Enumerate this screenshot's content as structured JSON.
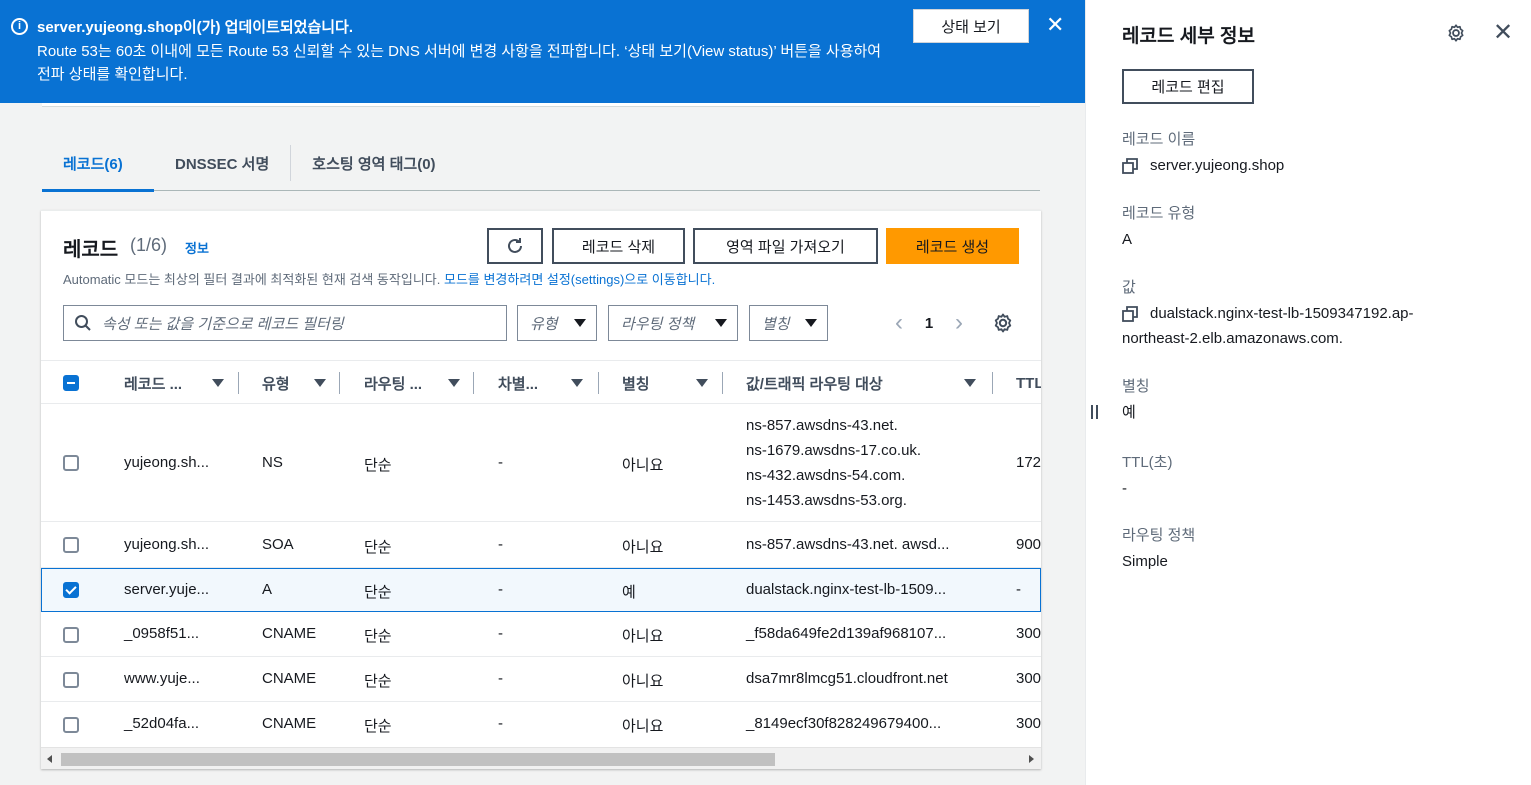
{
  "flash": {
    "icon": "info-icon",
    "title": "server.yujeong.shop이(가) 업데이트되었습니다.",
    "body": "Route 53는 60초 이내에 모든 Route 53 신뢰할 수 있는 DNS 서버에 변경 사항을 전파합니다. ‘상태 보기(View status)’ 버튼을 사용하여 전파 상태를 확인합니다.",
    "status_button": "상태 보기",
    "close_icon": "close-icon"
  },
  "tabs": [
    {
      "label": "레코드(6)",
      "active": true
    },
    {
      "label": "DNSSEC 서명",
      "active": false
    },
    {
      "label": "호스팅 영역 태그(0)",
      "active": false
    }
  ],
  "records": {
    "title": "레코드",
    "count": "(1/6)",
    "info_link": "정보",
    "description": "Automatic 모드는 최상의 필터 결과에 최적화된 현재 검색 동작입니다.",
    "description_link": "모드를 변경하려면 설정(settings)으로 이동합니다.",
    "buttons": {
      "delete": "레코드 삭제",
      "import": "영역 파일 가져오기",
      "create": "레코드 생성"
    },
    "filter_placeholder": "속성 또는 값을 기준으로 레코드 필터링",
    "dropdowns": {
      "type": "유형",
      "routing": "라우팅 정책",
      "alias": "별칭"
    },
    "page": "1",
    "columns": [
      "레코드 ...",
      "유형",
      "라우팅 ...",
      "차별...",
      "별칭",
      "값/트래픽 라우팅 대상",
      "TTL"
    ],
    "rows": [
      {
        "name": "yujeong.sh...",
        "type": "NS",
        "routing": "단순",
        "diff": "-",
        "alias": "아니요",
        "value": [
          "ns-857.awsdns-43.net.",
          "ns-1679.awsdns-17.co.uk.",
          "ns-432.awsdns-54.com.",
          "ns-1453.awsdns-53.org."
        ],
        "ttl": "172",
        "checked": false
      },
      {
        "name": "yujeong.sh...",
        "type": "SOA",
        "routing": "단순",
        "diff": "-",
        "alias": "아니요",
        "value": [
          "ns-857.awsdns-43.net. awsd..."
        ],
        "ttl": "900",
        "checked": false
      },
      {
        "name": "server.yuje...",
        "type": "A",
        "routing": "단순",
        "diff": "-",
        "alias": "예",
        "value": [
          "dualstack.nginx-test-lb-1509..."
        ],
        "ttl": "-",
        "checked": true
      },
      {
        "name": "_0958f51...",
        "type": "CNAME",
        "routing": "단순",
        "diff": "-",
        "alias": "아니요",
        "value": [
          "_f58da649fe2d139af968107..."
        ],
        "ttl": "300",
        "checked": false
      },
      {
        "name": "www.yuje...",
        "type": "CNAME",
        "routing": "단순",
        "diff": "-",
        "alias": "아니요",
        "value": [
          "dsa7mr8lmcg51.cloudfront.net"
        ],
        "ttl": "300",
        "checked": false
      },
      {
        "name": "_52d04fa...",
        "type": "CNAME",
        "routing": "단순",
        "diff": "-",
        "alias": "아니요",
        "value": [
          "_8149ecf30f828249679400..."
        ],
        "ttl": "300",
        "checked": false
      }
    ]
  },
  "details": {
    "title": "레코드 세부 정보",
    "edit_button": "레코드 편집",
    "fields": {
      "name_label": "레코드 이름",
      "name_value": "server.yujeong.shop",
      "type_label": "레코드 유형",
      "type_value": "A",
      "value_label": "값",
      "value_line1": "dualstack.nginx-test-lb-1509347192.ap-",
      "value_line2": "northeast-2.elb.amazonaws.com.",
      "alias_label": "별칭",
      "alias_value": "예",
      "ttl_label": "TTL(초)",
      "ttl_value": "-",
      "routing_label": "라우팅 정책",
      "routing_value": "Simple"
    }
  },
  "colors": {
    "flash_bg": "#0972d3",
    "link": "#0972d3",
    "primary_button": "#ff9900"
  }
}
